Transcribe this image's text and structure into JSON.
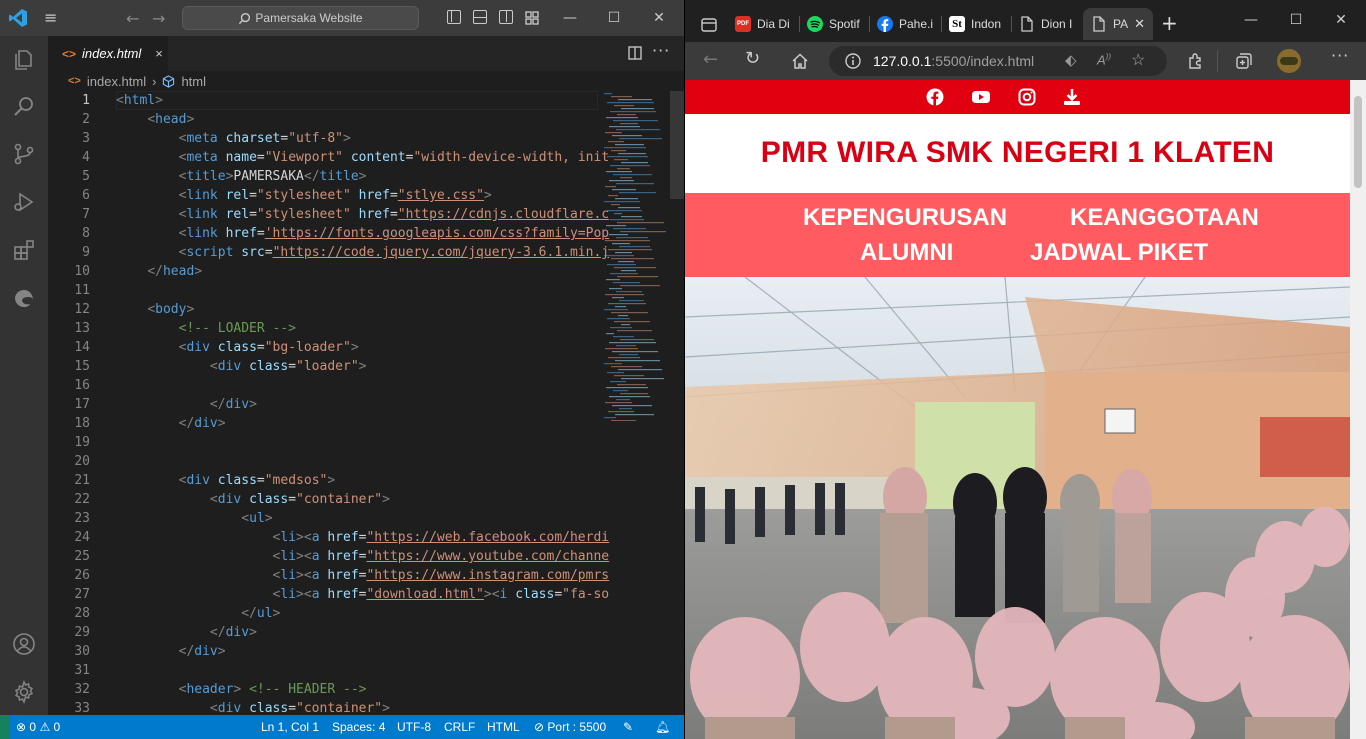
{
  "vscode": {
    "search_text": "Pamersaka Website",
    "tab": {
      "icon_label": "<>",
      "label": "index.html",
      "close": "×"
    },
    "breadcrumb": {
      "file": "index.html",
      "element": "html"
    },
    "lines": [
      {
        "n": "1",
        "t": "<html>"
      },
      {
        "n": "2",
        "t": "    <head>"
      },
      {
        "n": "3",
        "t": "        <meta charset=\"utf-8\">"
      },
      {
        "n": "4",
        "t": "        <meta name=\"Viewport\" content=\"width-device-width, init"
      },
      {
        "n": "5",
        "t": "        <title>PAMERSAKA</title>"
      },
      {
        "n": "6",
        "t": "        <link rel=\"stylesheet\" href=\"stlye.css\">"
      },
      {
        "n": "7",
        "t": "        <link rel=\"stylesheet\" href=\"https://cdnjs.cloudflare.c"
      },
      {
        "n": "8",
        "t": "        <link href='https://fonts.googleapis.com/css?family=Pop"
      },
      {
        "n": "9",
        "t": "        <script src=\"https://code.jquery.com/jquery-3.6.1.min.j"
      },
      {
        "n": "10",
        "t": "    </head>"
      },
      {
        "n": "11",
        "t": ""
      },
      {
        "n": "12",
        "t": "    <body>"
      },
      {
        "n": "13",
        "t": "        <!-- LOADER -->"
      },
      {
        "n": "14",
        "t": "        <div class=\"bg-loader\">"
      },
      {
        "n": "15",
        "t": "            <div class=\"loader\">"
      },
      {
        "n": "16",
        "t": ""
      },
      {
        "n": "17",
        "t": "            </div>"
      },
      {
        "n": "18",
        "t": "        </div>"
      },
      {
        "n": "19",
        "t": ""
      },
      {
        "n": "20",
        "t": ""
      },
      {
        "n": "21",
        "t": "        <div class=\"medsos\">"
      },
      {
        "n": "22",
        "t": "            <div class=\"container\">"
      },
      {
        "n": "23",
        "t": "                <ul>"
      },
      {
        "n": "24",
        "t": "                    <li><a href=\"https://web.facebook.com/herdi"
      },
      {
        "n": "25",
        "t": "                    <li><a href=\"https://www.youtube.com/channe"
      },
      {
        "n": "26",
        "t": "                    <li><a href=\"https://www.instagram.com/pmrs"
      },
      {
        "n": "27",
        "t": "                    <li><a href=\"download.html\"><i class=\"fa-so"
      },
      {
        "n": "28",
        "t": "                </ul>"
      },
      {
        "n": "29",
        "t": "            </div>"
      },
      {
        "n": "30",
        "t": "        </div>"
      },
      {
        "n": "31",
        "t": ""
      },
      {
        "n": "32",
        "t": "        <header> <!-- HEADER -->"
      },
      {
        "n": "33",
        "t": "            <div class=\"container\">"
      }
    ],
    "status": {
      "errors": "0",
      "warnings": "0",
      "position": "Ln 1, Col 1",
      "spaces": "Spaces: 4",
      "encoding": "UTF-8",
      "eol": "CRLF",
      "language": "HTML",
      "port": "Port : 5500"
    },
    "colors": {
      "titlebar": "#3c3c3c",
      "activity": "#333333",
      "statusbar": "#007acc",
      "editor": "#1e1e1e"
    }
  },
  "edge": {
    "tabs": [
      {
        "label": "Dia Di",
        "icon": "pdf-icon"
      },
      {
        "label": "Spotif",
        "icon": "spotify-icon"
      },
      {
        "label": "Pahe.i",
        "icon": "facebook-icon"
      },
      {
        "label": "Indon",
        "icon": "st-icon"
      },
      {
        "label": "Dion I",
        "icon": "page-icon"
      },
      {
        "label": "PA",
        "icon": "page-icon",
        "active": true
      }
    ],
    "address": {
      "host": "127.0.0.1",
      "rest": ":5500/index.html"
    },
    "site": {
      "title": "PMR WIRA SMK NEGERI 1 KLATEN",
      "nav": [
        "KEPENGURUSAN",
        "KEANGGOTAAN",
        "ALUMNI",
        "JADWAL PIKET"
      ],
      "social": [
        "facebook-icon",
        "youtube-icon",
        "instagram-icon",
        "download-icon"
      ],
      "colors": {
        "medsos_bar": "#e0000f",
        "title": "#d80012",
        "nav_bg": "#ff5b60"
      }
    }
  }
}
